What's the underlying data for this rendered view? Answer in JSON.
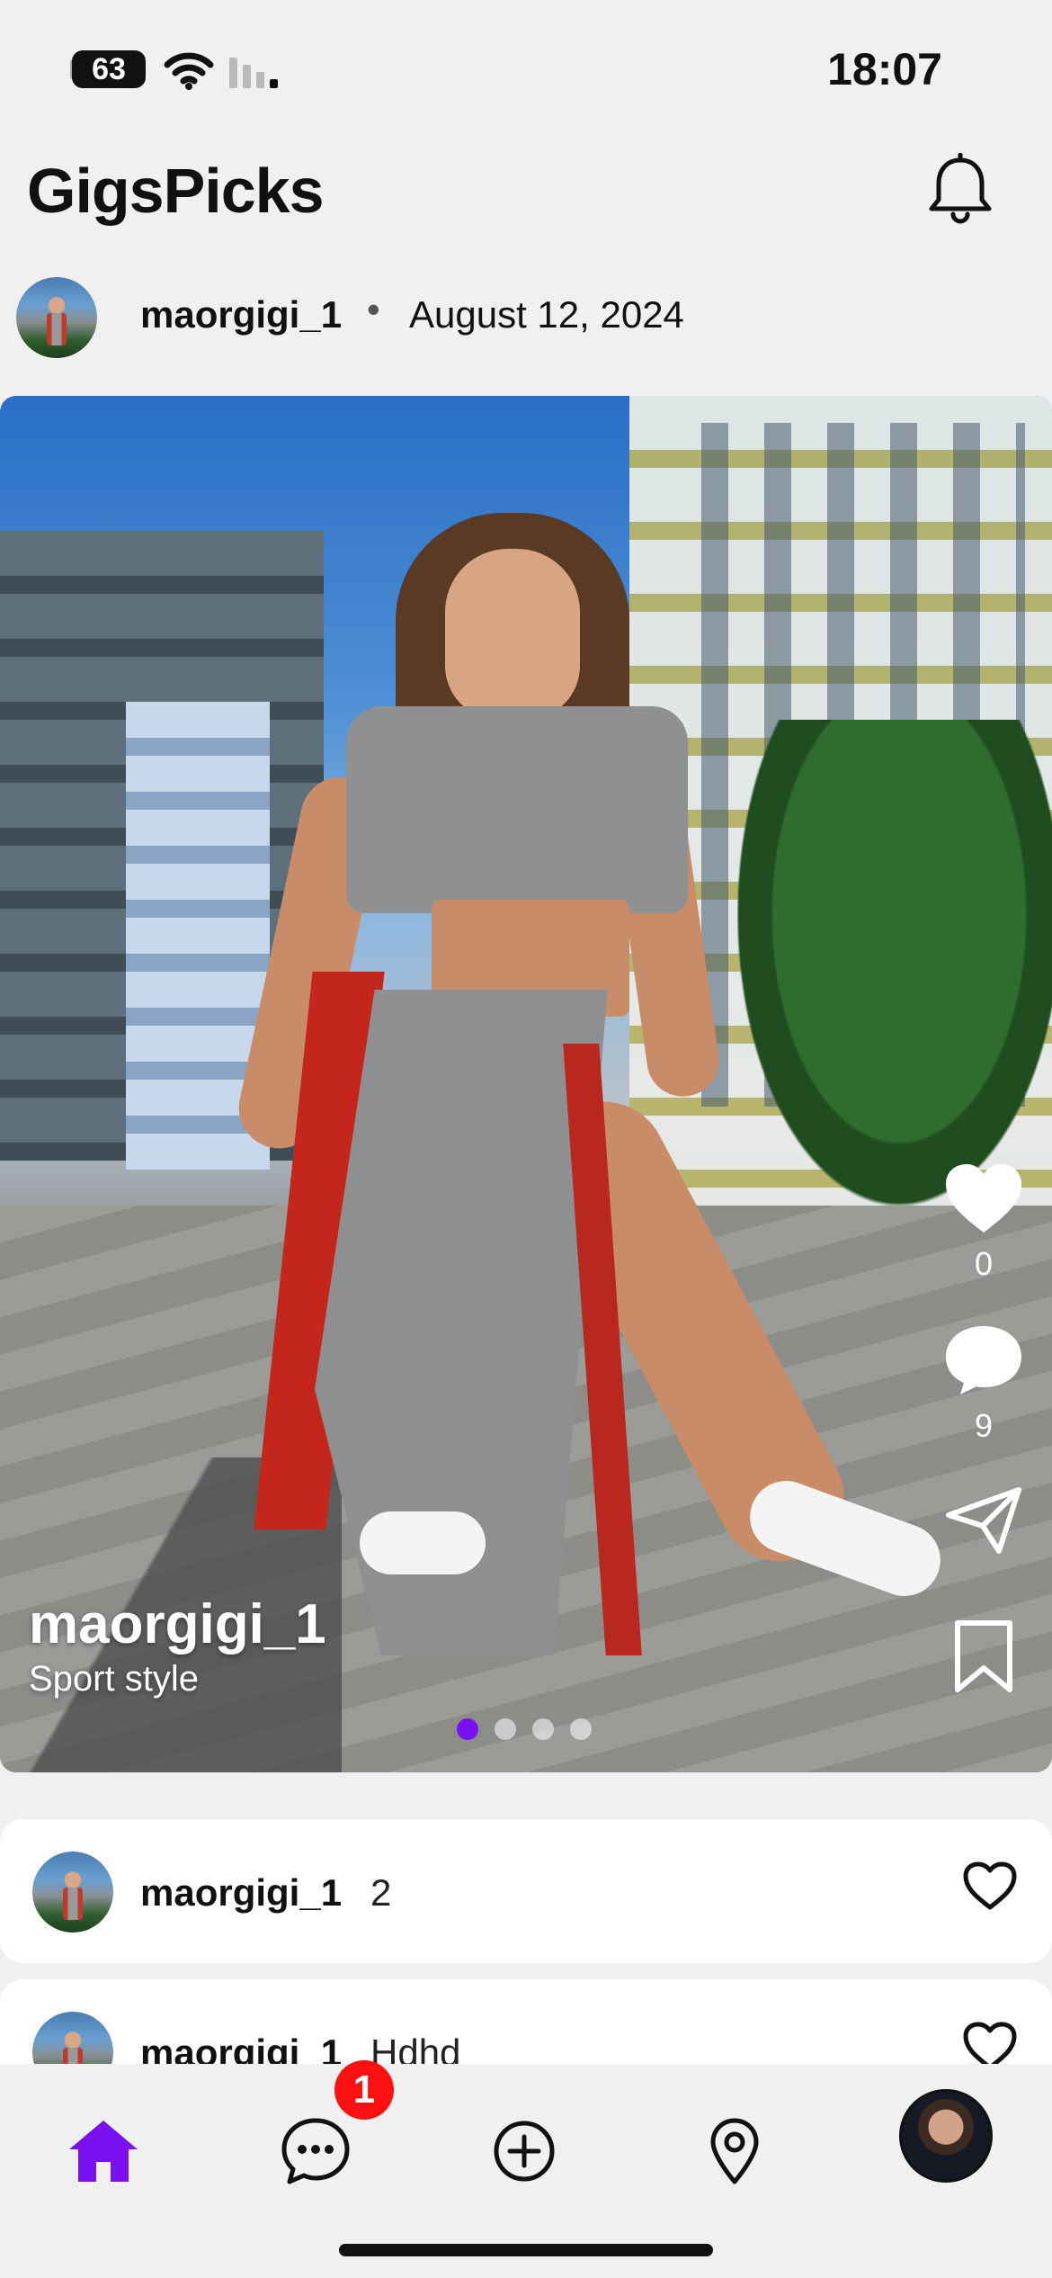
{
  "status_bar": {
    "battery": "63",
    "time": "18:07"
  },
  "header": {
    "title": "GigsPicks",
    "bell_icon": "bell-icon"
  },
  "post": {
    "username": "maorgigi_1",
    "separator": "•",
    "date": "August 12, 2024",
    "media": {
      "overlay_username": "maorgigi_1",
      "caption": "Sport style",
      "page_dots": {
        "count": 4,
        "active_index": 0
      }
    },
    "actions": {
      "like_count": "0",
      "comment_count": "9"
    }
  },
  "comments": [
    {
      "username": "maorgigi_1",
      "text": "2"
    },
    {
      "username": "maorgigi_1",
      "text": "Hdhd"
    }
  ],
  "tabbar": {
    "items": [
      "home-icon",
      "messages-icon",
      "create-icon",
      "map-pin-icon",
      "profile-avatar"
    ],
    "messages_badge": "1",
    "active": "home"
  },
  "colors": {
    "accent": "#7a10f0",
    "badge": "#ff1111",
    "background": "#f0f0f0"
  }
}
